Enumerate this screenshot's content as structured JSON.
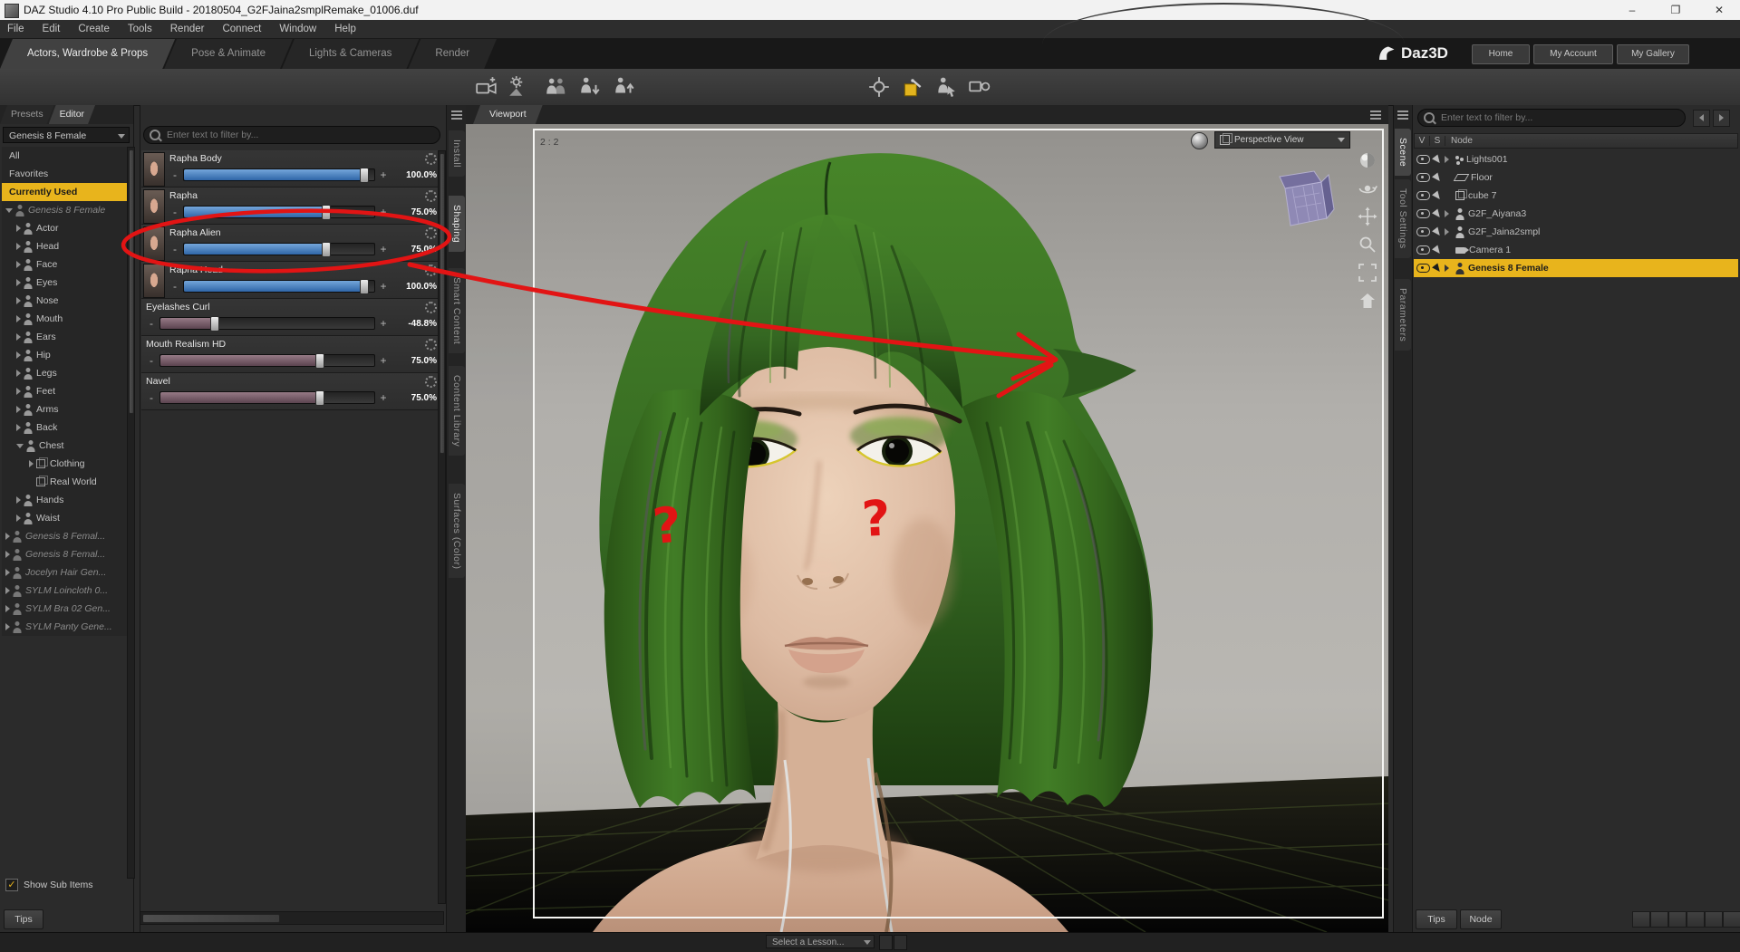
{
  "window": {
    "title": "DAZ Studio 4.10 Pro Public Build - 20180504_G2FJaina2smplRemake_01006.duf",
    "minimize": "–",
    "maximize": "❐",
    "close": "✕"
  },
  "menu": {
    "items": [
      "File",
      "Edit",
      "Create",
      "Tools",
      "Render",
      "Connect",
      "Window",
      "Help"
    ]
  },
  "workspace_tabs": [
    "Actors, Wardrobe & Props",
    "Pose & Animate",
    "Lights & Cameras",
    "Render"
  ],
  "brand": {
    "logo": "Daz3D",
    "home": "Home",
    "account": "My Account",
    "gallery": "My Gallery"
  },
  "left_panel": {
    "presets_tab": "Presets",
    "editor_tab": "Editor",
    "figure_selector": "Genesis 8 Female",
    "items": [
      "All",
      "Favorites",
      "Currently Used",
      "Genesis 8 Female",
      "Actor",
      "Head",
      "Face",
      "Eyes",
      "Nose",
      "Mouth",
      "Ears",
      "Hip",
      "Legs",
      "Feet",
      "Arms",
      "Back",
      "Chest",
      "Clothing",
      "Real World",
      "Hands",
      "Waist",
      "Genesis 8 Femal...",
      "Genesis 8 Femal...",
      "Jocelyn Hair Gen...",
      "SYLM Loincloth 0...",
      "SYLM Bra 02 Gen...",
      "SYLM Panty Gene..."
    ],
    "show_sub_items": "Show Sub Items",
    "tips": "Tips"
  },
  "shaping_panel": {
    "filter_placeholder": "Enter text to filter by...",
    "minus": "-",
    "plus": "+",
    "sliders": [
      {
        "label": "Rapha Body",
        "value": "100.0%",
        "fill": 95
      },
      {
        "label": "Rapha",
        "value": "75.0%",
        "fill": 75
      },
      {
        "label": "Rapha Alien",
        "value": "75.0%",
        "fill": 75
      },
      {
        "label": "Rapha Head",
        "value": "100.0%",
        "fill": 95
      },
      {
        "label": "Eyelashes Curl",
        "value": "-48.8%",
        "fill": 26
      },
      {
        "label": "Mouth Realism HD",
        "value": "75.0%",
        "fill": 75
      },
      {
        "label": "Navel",
        "value": "75.0%",
        "fill": 75
      }
    ]
  },
  "dock_tabs_left": [
    "Install",
    "Shaping",
    "Smart Content",
    "Content Library",
    "Surfaces (Color)"
  ],
  "viewport": {
    "tab": "Viewport",
    "ratio": "2 : 2",
    "view_selector": "Perspective View"
  },
  "dock_tabs_right": [
    "Scene",
    "Tool Settings",
    "Parameters"
  ],
  "scene_panel": {
    "filter_placeholder": "Enter text to filter by...",
    "columns": [
      "V",
      "S",
      "Node"
    ],
    "nodes": [
      "Lights001",
      "Floor",
      "cube 7",
      "G2F_Aiyana3",
      "G2F_Jaina2smpl",
      "Camera 1",
      "Genesis 8 Female"
    ],
    "tips": "Tips",
    "node_label": "Node"
  },
  "bottom_bar": {
    "lesson_selector": "Select a Lesson..."
  },
  "annotations": {
    "question_mark": "?"
  },
  "colors": {
    "selection": "#e8b41c",
    "annotation_red": "#e21414",
    "slider_blue": "#2f66a8"
  }
}
